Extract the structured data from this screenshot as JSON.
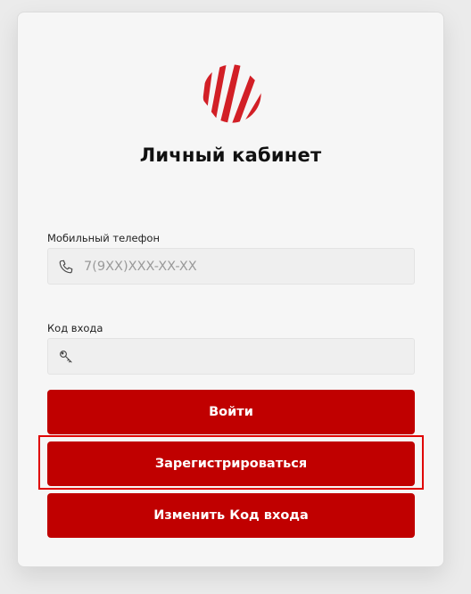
{
  "login": {
    "title": "Личный кабинет",
    "phone_label": "Мобильный телефон",
    "phone_placeholder": "7(9XX)XXX-XX-XX",
    "phone_value": "",
    "code_label": "Код входа",
    "code_value": "",
    "login_button": "Войти",
    "register_button": "Зарегистрироваться",
    "change_code_button": "Изменить Код входа"
  },
  "icons": {
    "logo": "brand-logo-icon",
    "phone": "phone-icon",
    "code": "key-icon"
  },
  "colors": {
    "accent": "#c00000",
    "highlight": "#e00000",
    "card_background": "#f6f6f6",
    "page_background": "#ebebeb"
  }
}
